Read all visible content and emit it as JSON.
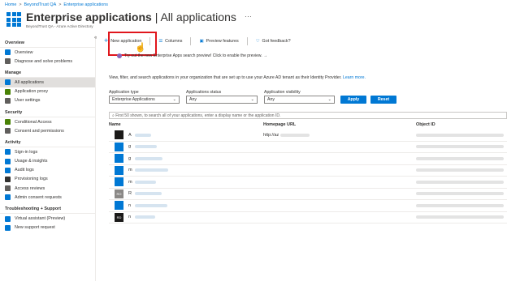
{
  "breadcrumb": [
    "Home",
    "BeyondTrust QA",
    "Enterprise applications"
  ],
  "header": {
    "title_bold": "Enterprise applications",
    "title_light": " | All applications",
    "subtitle": "BeyondTrust QA - Azure Active Directory",
    "more": "···"
  },
  "sidebar": {
    "collapse": "«",
    "sections": [
      {
        "title": "Overview",
        "items": [
          {
            "label": "Overview",
            "icon": "info-icon",
            "color": "#0078d4"
          },
          {
            "label": "Diagnose and solve problems",
            "icon": "wrench-icon",
            "color": "#605e5c"
          }
        ]
      },
      {
        "title": "Manage",
        "items": [
          {
            "label": "All applications",
            "icon": "grid-icon",
            "color": "#0078d4",
            "active": true
          },
          {
            "label": "Application proxy",
            "icon": "proxy-icon",
            "color": "#498205"
          },
          {
            "label": "User settings",
            "icon": "gear-icon",
            "color": "#605e5c"
          }
        ]
      },
      {
        "title": "Security",
        "items": [
          {
            "label": "Conditional Access",
            "icon": "conditional-access-icon",
            "color": "#498205"
          },
          {
            "label": "Consent and permissions",
            "icon": "gear-icon",
            "color": "#605e5c"
          }
        ]
      },
      {
        "title": "Activity",
        "items": [
          {
            "label": "Sign-in logs",
            "icon": "signin-icon",
            "color": "#0078d4"
          },
          {
            "label": "Usage & insights",
            "icon": "chart-icon",
            "color": "#0078d4"
          },
          {
            "label": "Audit logs",
            "icon": "audit-icon",
            "color": "#0078d4"
          },
          {
            "label": "Provisioning logs",
            "icon": "person-icon",
            "color": "#323130"
          },
          {
            "label": "Access reviews",
            "icon": "list-icon",
            "color": "#605e5c"
          },
          {
            "label": "Admin consent requests",
            "icon": "globe-icon",
            "color": "#0078d4"
          }
        ]
      },
      {
        "title": "Troubleshooting + Support",
        "items": [
          {
            "label": "Virtual assistant (Preview)",
            "icon": "assistant-icon",
            "color": "#0078d4"
          },
          {
            "label": "New support request",
            "icon": "support-icon",
            "color": "#0078d4"
          }
        ]
      }
    ]
  },
  "toolbar": {
    "new_application": "New application",
    "columns": "Columns",
    "preview_features": "Preview features",
    "got_feedback": "Got feedback?"
  },
  "banner": "Try out the new Enterprise Apps search preview! Click to enable the preview. →",
  "intro": {
    "text": "View, filter, and search applications in your organization that are set up to use your Azure AD tenant as their Identity Provider. ",
    "link": "Learn more."
  },
  "filters": {
    "app_type_label": "Application type",
    "app_type_value": "Enterprise Applications",
    "status_label": "Applications status",
    "status_value": "Any",
    "visibility_label": "Application visibility",
    "visibility_value": "Any",
    "apply": "Apply",
    "reset": "Reset"
  },
  "search_placeholder": "First 50 shown, to search all of your applications, enter a display name or the application ID.",
  "table": {
    "headers": [
      "Name",
      "Homepage URL",
      "Object ID"
    ],
    "rows": [
      {
        "initial": "A",
        "icon_color": "#1b1a19",
        "icon_text": "",
        "url": "http://az"
      },
      {
        "initial": "g",
        "icon_color": "#0078d4",
        "icon_text": "",
        "url": ""
      },
      {
        "initial": "g",
        "icon_color": "#0078d4",
        "icon_text": "",
        "url": ""
      },
      {
        "initial": "m",
        "icon_color": "#0078d4",
        "icon_text": "",
        "url": ""
      },
      {
        "initial": "m",
        "icon_color": "#0078d4",
        "icon_text": "",
        "url": ""
      },
      {
        "initial": "R",
        "icon_color": "#8a8886",
        "icon_text": "RO",
        "url": ""
      },
      {
        "initial": "n",
        "icon_color": "#0078d4",
        "icon_text": "",
        "url": ""
      },
      {
        "initial": "n",
        "icon_color": "#1b1a19",
        "icon_text": "RD",
        "url": ""
      }
    ]
  }
}
